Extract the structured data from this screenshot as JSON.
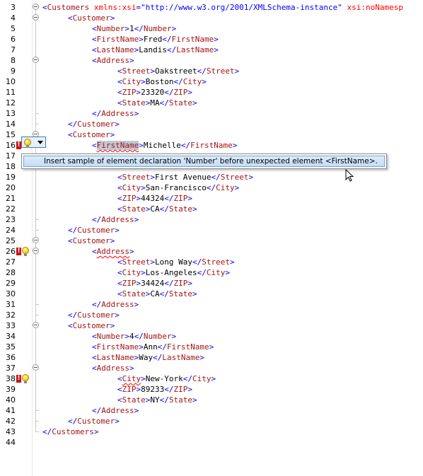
{
  "editor": {
    "lines": {
      "l3": {
        "num": "3",
        "open": "<",
        "tag": "Customers",
        "attr1": "xmlns:xsi",
        "eq1": "=",
        "val1": "\"http://www.w3.org/2001/XMLSchema-instance\"",
        "attr2": "xsi:noNamesp"
      },
      "l4": {
        "num": "4",
        "open": "<",
        "tag": "Customer",
        "close": ">"
      },
      "l5": {
        "num": "5",
        "open": "<",
        "tag": "Number",
        "close": ">",
        "text": "1",
        "eopen": "</",
        "etag": "Number",
        "eclose": ">"
      },
      "l6": {
        "num": "6",
        "open": "<",
        "tag": "FirstName",
        "close": ">",
        "text": "Fred",
        "eopen": "</",
        "etag": "FirstName",
        "eclose": ">"
      },
      "l7": {
        "num": "7",
        "open": "<",
        "tag": "LastName",
        "close": ">",
        "text": "Landis",
        "eopen": "</",
        "etag": "LastName",
        "eclose": ">"
      },
      "l8": {
        "num": "8",
        "open": "<",
        "tag": "Address",
        "close": ">"
      },
      "l9": {
        "num": "9",
        "open": "<",
        "tag": "Street",
        "close": ">",
        "text": "Oakstreet",
        "eopen": "</",
        "etag": "Street",
        "eclose": ">"
      },
      "l10": {
        "num": "10",
        "open": "<",
        "tag": "City",
        "close": ">",
        "text": "Boston",
        "eopen": "</",
        "etag": "City",
        "eclose": ">"
      },
      "l11": {
        "num": "11",
        "open": "<",
        "tag": "ZIP",
        "close": ">",
        "text": "23320",
        "eopen": "</",
        "etag": "ZIP",
        "eclose": ">"
      },
      "l12": {
        "num": "12",
        "open": "<",
        "tag": "State",
        "close": ">",
        "text": "MA",
        "eopen": "</",
        "etag": "State",
        "eclose": ">"
      },
      "l13": {
        "num": "13",
        "eopen": "</",
        "etag": "Address",
        "eclose": ">"
      },
      "l14": {
        "num": "14",
        "eopen": "</",
        "etag": "Customer",
        "eclose": ">"
      },
      "l15": {
        "num": "15",
        "open": "<",
        "tag": "Customer",
        "close": ">"
      },
      "l16": {
        "num": "16",
        "open": "<",
        "tag": "FirstName",
        "close": ">",
        "text": "Michelle",
        "eopen": "</",
        "etag": "FirstName",
        "eclose": ">"
      },
      "l17": {
        "num": "17"
      },
      "l18": {
        "num": "18"
      },
      "l19": {
        "num": "19",
        "open": "<",
        "tag": "Street",
        "close": ">",
        "text": "First Avenue",
        "eopen": "</",
        "etag": "Street",
        "eclose": ">"
      },
      "l20": {
        "num": "20",
        "open": "<",
        "tag": "City",
        "close": ">",
        "text": "San-Francisco",
        "eopen": "</",
        "etag": "City",
        "eclose": ">"
      },
      "l21": {
        "num": "21",
        "open": "<",
        "tag": "ZIP",
        "close": ">",
        "text": "44324",
        "eopen": "</",
        "etag": "ZIP",
        "eclose": ">"
      },
      "l22": {
        "num": "22",
        "open": "<",
        "tag": "State",
        "close": ">",
        "text": "CA",
        "eopen": "</",
        "etag": "State",
        "eclose": ">"
      },
      "l23": {
        "num": "23",
        "eopen": "</",
        "etag": "Address",
        "eclose": ">"
      },
      "l24": {
        "num": "24",
        "eopen": "</",
        "etag": "Customer",
        "eclose": ">"
      },
      "l25": {
        "num": "25",
        "open": "<",
        "tag": "Customer",
        "close": ">"
      },
      "l26": {
        "num": "26",
        "open": "<",
        "tag": "Address",
        "close": ">"
      },
      "l27": {
        "num": "27",
        "open": "<",
        "tag": "Street",
        "close": ">",
        "text": "Long Way",
        "eopen": "</",
        "etag": "Street",
        "eclose": ">"
      },
      "l28": {
        "num": "28",
        "open": "<",
        "tag": "City",
        "close": ">",
        "text": "Los-Angeles",
        "eopen": "</",
        "etag": "City",
        "eclose": ">"
      },
      "l29": {
        "num": "29",
        "open": "<",
        "tag": "ZIP",
        "close": ">",
        "text": "34424",
        "eopen": "</",
        "etag": "ZIP",
        "eclose": ">"
      },
      "l30": {
        "num": "30",
        "open": "<",
        "tag": "State",
        "close": ">",
        "text": "CA",
        "eopen": "</",
        "etag": "State",
        "eclose": ">"
      },
      "l31": {
        "num": "31",
        "eopen": "</",
        "etag": "Address",
        "eclose": ">"
      },
      "l32": {
        "num": "32",
        "eopen": "</",
        "etag": "Customer",
        "eclose": ">"
      },
      "l33": {
        "num": "33",
        "open": "<",
        "tag": "Customer",
        "close": ">"
      },
      "l34": {
        "num": "34",
        "open": "<",
        "tag": "Number",
        "close": ">",
        "text": "4",
        "eopen": "</",
        "etag": "Number",
        "eclose": ">"
      },
      "l35": {
        "num": "35",
        "open": "<",
        "tag": "FirstName",
        "close": ">",
        "text": "Ann",
        "eopen": "</",
        "etag": "FirstName",
        "eclose": ">"
      },
      "l36": {
        "num": "36",
        "open": "<",
        "tag": "LastName",
        "close": ">",
        "text": "Way",
        "eopen": "</",
        "etag": "LastName",
        "eclose": ">"
      },
      "l37": {
        "num": "37",
        "open": "<",
        "tag": "Address",
        "close": ">"
      },
      "l38": {
        "num": "38",
        "open": "<",
        "tag": "City",
        "close": ">",
        "text": "New-York",
        "eopen": "</",
        "etag": "City",
        "eclose": ">"
      },
      "l39": {
        "num": "39",
        "open": "<",
        "tag": "ZIP",
        "close": ">",
        "text": "89233",
        "eopen": "</",
        "etag": "ZIP",
        "eclose": ">"
      },
      "l40": {
        "num": "40",
        "open": "<",
        "tag": "State",
        "close": ">",
        "text": "NY",
        "eopen": "</",
        "etag": "State",
        "eclose": ">"
      },
      "l41": {
        "num": "41",
        "eopen": "</",
        "etag": "Address",
        "eclose": ">"
      },
      "l42": {
        "num": "42",
        "eopen": "</",
        "etag": "Customer",
        "eclose": ">"
      },
      "l43": {
        "num": "43",
        "eopen": "</",
        "etag": "Customers",
        "eclose": ">"
      },
      "l44": {
        "num": "44"
      }
    }
  },
  "gutter_icons": {
    "error_glyph": "!",
    "error_color": "#c81414",
    "bulb_color": "#f4c81c"
  },
  "quickfix_popup": {
    "item_label": "Insert sample of element declaration 'Number' before unexpected element <FirstName>."
  },
  "colors": {
    "tag": "#a31515",
    "bracket": "#0000ff",
    "attribute": "#ff0000",
    "value": "#0000ff",
    "selection": "#c0c8d4"
  }
}
